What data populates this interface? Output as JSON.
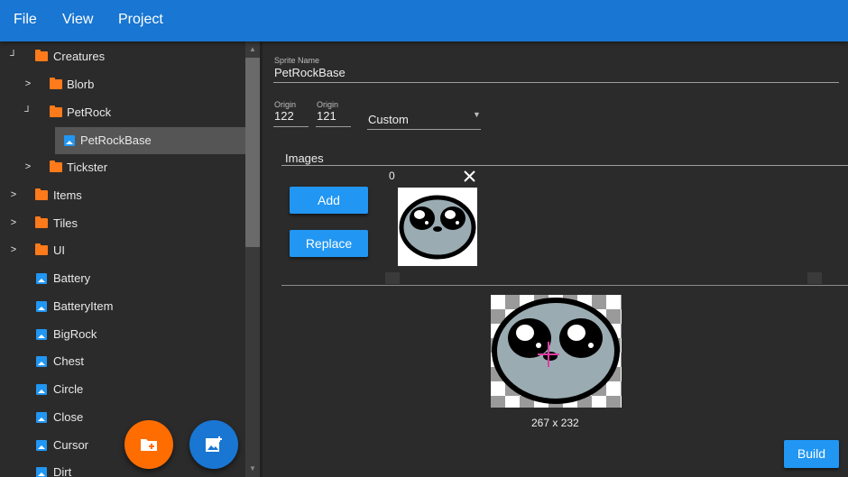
{
  "menu": {
    "file": "File",
    "view": "View",
    "project": "Project"
  },
  "tree": {
    "rows": [
      {
        "label": "Creatures",
        "type": "folder",
        "arrow": "┘"
      },
      {
        "label": "Blorb",
        "type": "folder",
        "arrow": ">"
      },
      {
        "label": "PetRock",
        "type": "folder",
        "arrow": "┘"
      },
      {
        "label": "PetRockBase",
        "type": "image",
        "arrow": ""
      },
      {
        "label": "Tickster",
        "type": "folder",
        "arrow": ">"
      },
      {
        "label": "Items",
        "type": "folder",
        "arrow": ">"
      },
      {
        "label": "Tiles",
        "type": "folder",
        "arrow": ">"
      },
      {
        "label": "UI",
        "type": "folder",
        "arrow": ">"
      },
      {
        "label": "Battery",
        "type": "image",
        "arrow": ""
      },
      {
        "label": "BatteryItem",
        "type": "image",
        "arrow": ""
      },
      {
        "label": "BigRock",
        "type": "image",
        "arrow": ""
      },
      {
        "label": "Chest",
        "type": "image",
        "arrow": ""
      },
      {
        "label": "Circle",
        "type": "image",
        "arrow": ""
      },
      {
        "label": "Close",
        "type": "image",
        "arrow": ""
      },
      {
        "label": "Cursor",
        "type": "image",
        "arrow": ""
      },
      {
        "label": "Dirt",
        "type": "image",
        "arrow": ""
      }
    ],
    "selected": "PetRockBase"
  },
  "sprite": {
    "name_label": "Sprite Name",
    "name_value": "PetRockBase",
    "origin_x_label": "Origin",
    "origin_x_value": "122",
    "origin_y_label": "Origin",
    "origin_y_value": "121",
    "origin_mode": "Custom"
  },
  "images": {
    "section_label": "Images",
    "add_label": "Add",
    "replace_label": "Replace",
    "thumb_index": "0",
    "preview_size": "267 x 232"
  },
  "build_label": "Build",
  "colors": {
    "menubar": "#1976d2",
    "accent": "#2196f3",
    "folder": "#ff7a1a",
    "fab_orange": "#ff6d00"
  }
}
